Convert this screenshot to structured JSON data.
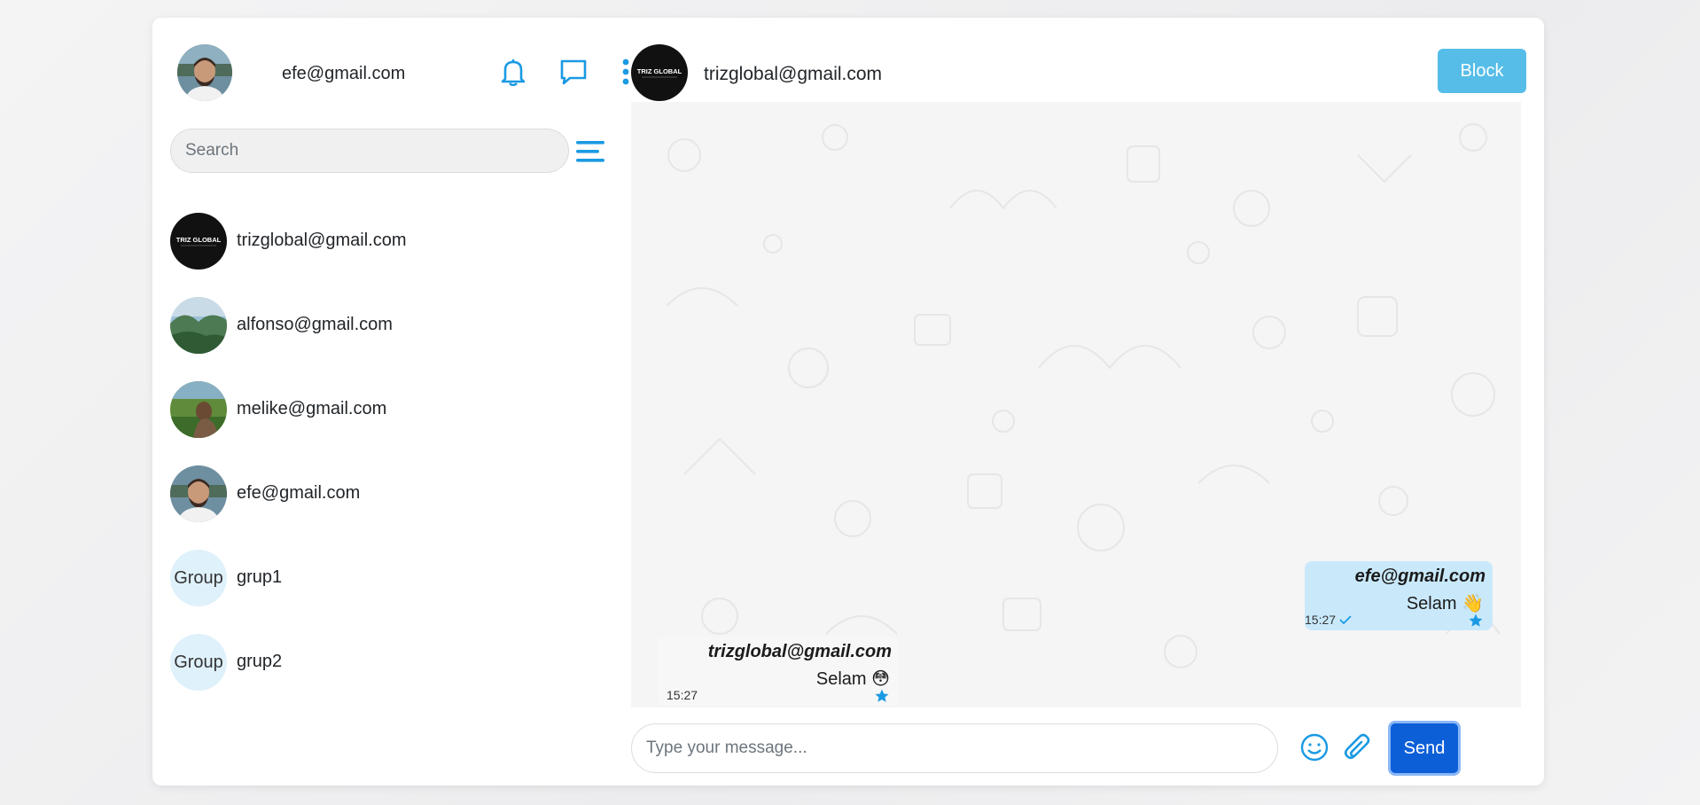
{
  "colors": {
    "accent": "#1a9ae3",
    "block_button": "#55bde8",
    "send_button": "#0d5fd8",
    "outgoing_bubble": "#c9e9fb",
    "chat_background": "#f5f5f5"
  },
  "sidebar": {
    "current_user": "efe@gmail.com",
    "icons": [
      "bell-icon",
      "chat-bubble-icon",
      "more-vertical-icon"
    ],
    "search": {
      "placeholder": "Search",
      "value": ""
    },
    "contacts": [
      {
        "name": "trizglobal@gmail.com",
        "avatar": "trizglobal-logo"
      },
      {
        "name": "alfonso@gmail.com",
        "avatar": "photo"
      },
      {
        "name": "melike@gmail.com",
        "avatar": "photo"
      },
      {
        "name": "efe@gmail.com",
        "avatar": "photo"
      },
      {
        "name": "grup1",
        "avatar_alt": "Group"
      },
      {
        "name": "grup2",
        "avatar_alt": "Group"
      }
    ]
  },
  "chat": {
    "title": "trizglobal@gmail.com",
    "logo_text": "TRIZ GLOBAL",
    "block_label": "Block",
    "messages": [
      {
        "sender": "efe@gmail.com",
        "text": "Selam 👋",
        "time": "15:27",
        "read": true,
        "starred": true,
        "direction": "outgoing"
      },
      {
        "sender": "trizglobal@gmail.com",
        "text": "Selam 😳",
        "time": "15:27",
        "read": false,
        "starred": true,
        "direction": "incoming"
      }
    ],
    "compose": {
      "placeholder": "Type your message...",
      "value": ""
    },
    "send_label": "Send"
  }
}
